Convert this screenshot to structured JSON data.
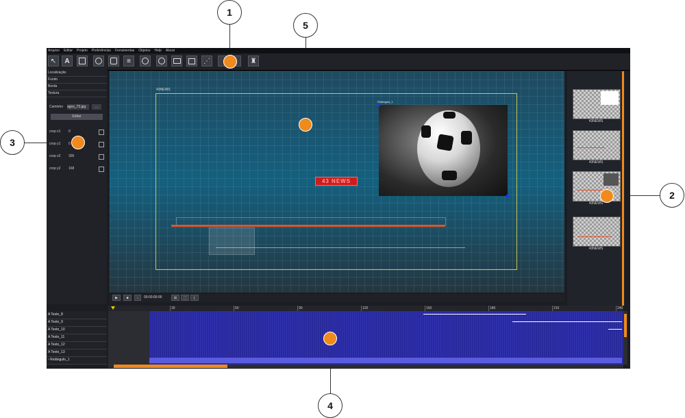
{
  "callouts": [
    "1",
    "2",
    "3",
    "4",
    "5"
  ],
  "menu": [
    "Arquivo",
    "Editar",
    "Projeto",
    "Preferências",
    "Ferramentas",
    "Objetos",
    "Help",
    "About"
  ],
  "left_panel": {
    "sections": [
      "Localização",
      "Fundo",
      "Borda",
      "Textura"
    ],
    "path_label": "Caminho",
    "path_value": "agos_73.jpg",
    "browse_label": "...",
    "edit_label": "Editar",
    "crops": [
      {
        "label": "crop x1",
        "value": "0"
      },
      {
        "label": "crop y1",
        "value": "0"
      },
      {
        "label": "crop x2",
        "value": "300"
      },
      {
        "label": "crop y2",
        "value": "168"
      }
    ]
  },
  "canvas": {
    "frame_label": "43NEWS",
    "red_label": "43 NEWS",
    "image_label": "Retângulo_1"
  },
  "thumbnails": [
    "43NEWS",
    "43NEWS",
    "43NEWS",
    "43NEWS"
  ],
  "playbar": {
    "timecode": "00:00:00:00"
  },
  "timeline": {
    "ruler": [
      "30",
      "60",
      "90",
      "120",
      "150",
      "180",
      "210",
      "240"
    ],
    "tracks": [
      "Texto_8",
      "Texto_9",
      "Texto_10",
      "Texto_11",
      "Texto_12",
      "Texto_13",
      "Retângulo_1"
    ]
  },
  "colors": {
    "accent": "#f08a1c",
    "timeline_frames": "#2a2ca8",
    "canvas_bg": "#14607f"
  }
}
